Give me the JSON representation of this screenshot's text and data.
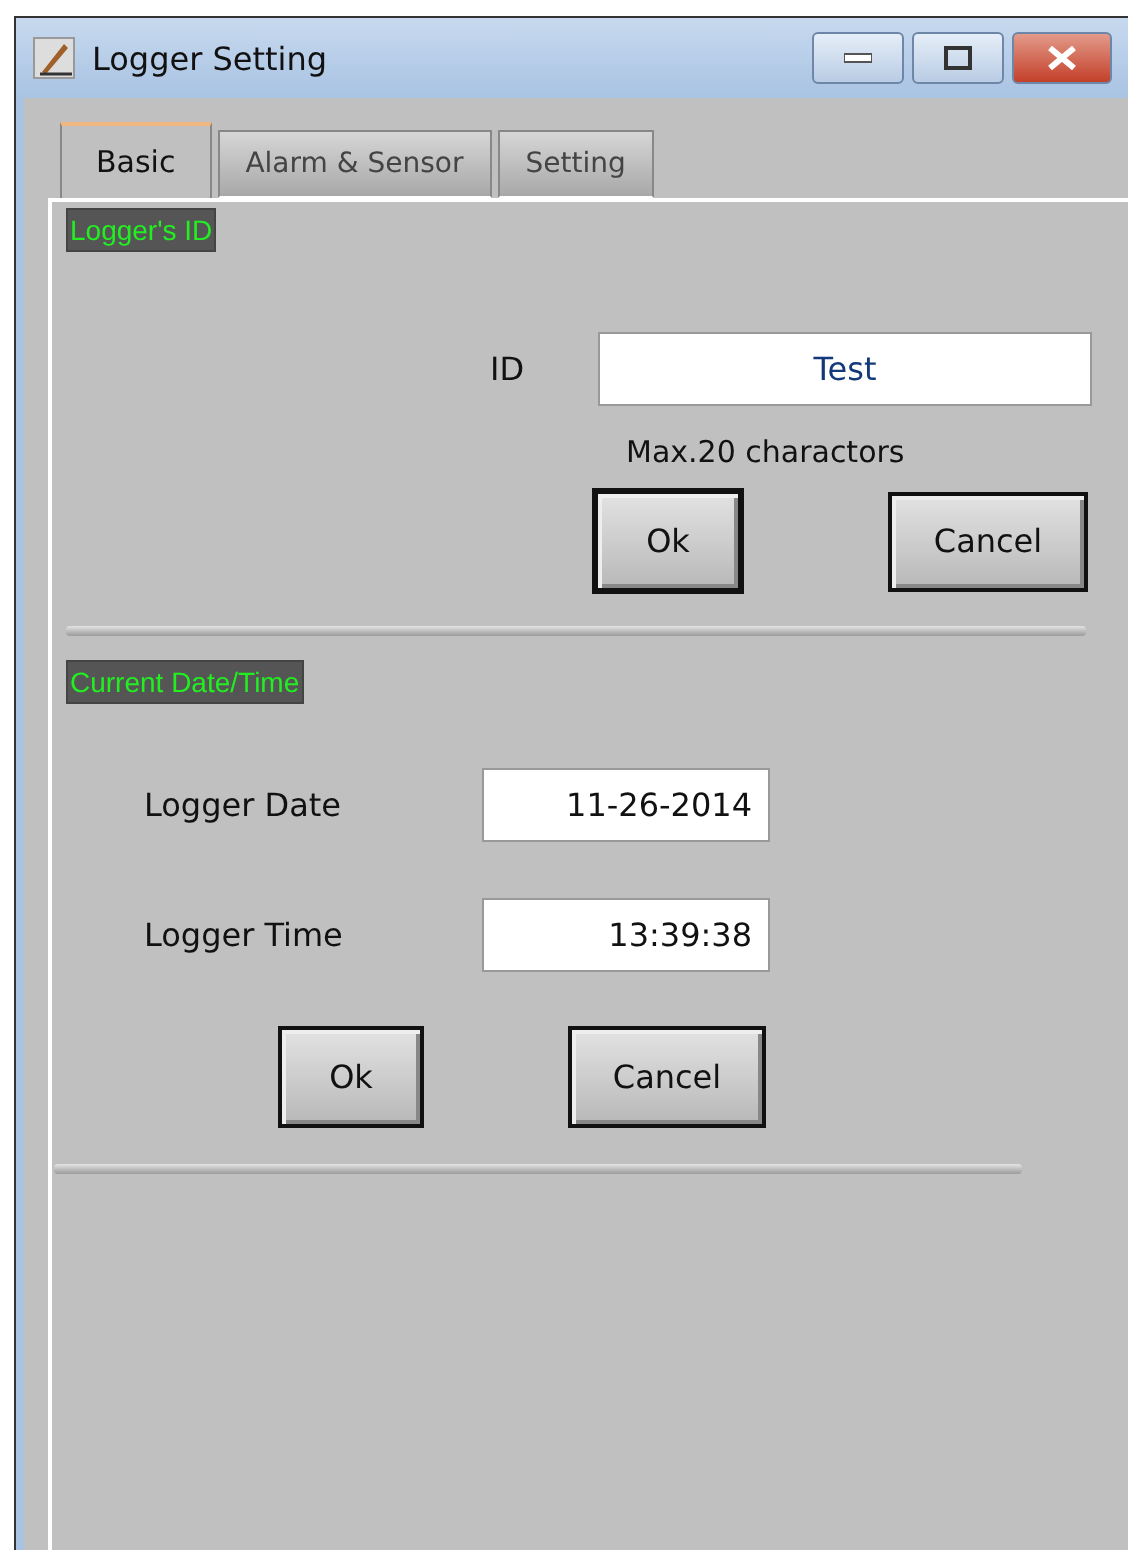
{
  "window": {
    "title": "Logger Setting"
  },
  "tabs": [
    {
      "label": "Basic",
      "selected": true
    },
    {
      "label": "Alarm & Sensor",
      "selected": false
    },
    {
      "label": "Setting",
      "selected": false
    }
  ],
  "id_section": {
    "heading": "Logger's ID",
    "label": "ID",
    "value": "Test",
    "hint": "Max.20 charactors",
    "buttons": [
      {
        "label": "Ok",
        "default": true
      },
      {
        "label": "Cancel",
        "default": false
      }
    ]
  },
  "datetime_section": {
    "heading": "Current Date/Time",
    "fields": [
      {
        "label": "Logger Date",
        "value": "11-26-2014"
      },
      {
        "label": "Logger Time",
        "value": "13:39:38"
      }
    ],
    "buttons": [
      {
        "label": "Ok",
        "default": false
      },
      {
        "label": "Cancel",
        "default": false
      }
    ]
  }
}
